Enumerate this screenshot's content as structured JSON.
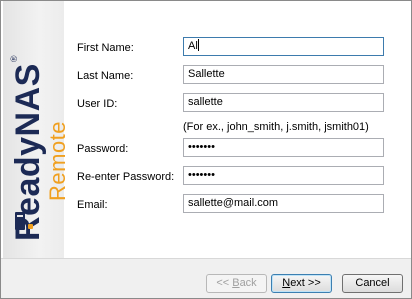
{
  "brand": {
    "name": "ReadyNAS",
    "registered_mark": "®",
    "subtitle": "Remote",
    "primary_color": "#1c2a55",
    "accent_color": "#f0a020"
  },
  "form": {
    "first_name": {
      "label": "First Name:",
      "value": "Al"
    },
    "last_name": {
      "label": "Last Name:",
      "value": "Sallette"
    },
    "user_id": {
      "label": "User ID:",
      "value": "sallette",
      "hint": "(For ex., john_smith, j.smith, jsmith01)"
    },
    "password": {
      "label": "Password:",
      "value": "•••••••"
    },
    "reenter_password": {
      "label": "Re-enter Password:",
      "value": "•••••••"
    },
    "email": {
      "label": "Email:",
      "value": "sallette@mail.com"
    }
  },
  "buttons": {
    "back": {
      "prefix": "<< ",
      "accel": "B",
      "rest": "ack",
      "enabled": false
    },
    "next": {
      "accel": "N",
      "rest": "ext >>",
      "enabled": true
    },
    "cancel": {
      "label": "Cancel",
      "enabled": true
    }
  }
}
